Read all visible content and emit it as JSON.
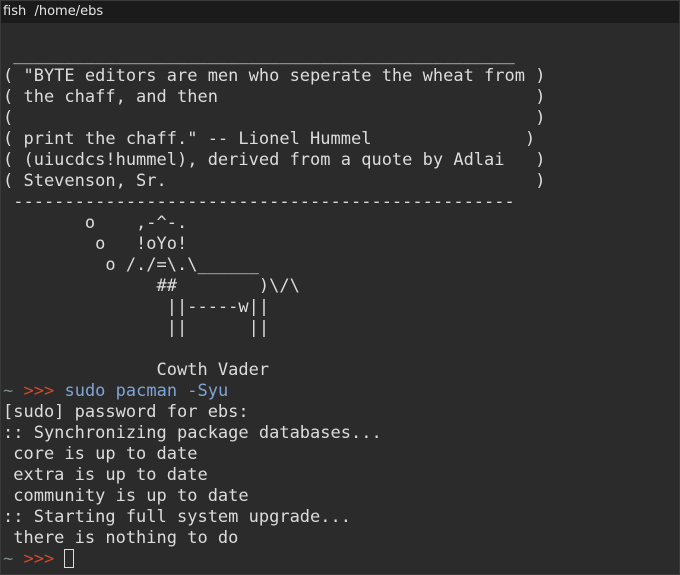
{
  "window": {
    "title": "fish  /home/ebs"
  },
  "cowsay": {
    "lines": [
      " _________________________________________________",
      "( \"BYTE editors are men who seperate the wheat from )",
      "( the chaff, and then                               )",
      "(                                                   )",
      "( print the chaff.\" -- Lionel Hummel               )",
      "( (uiucdcs!hummel), derived from a quote by Adlai   )",
      "( Stevenson, Sr.                                    )",
      " -------------------------------------------------",
      "        o    ,-^-.",
      "         o   !oYo!",
      "          o /./=\\.\\______",
      "               ##        )\\/\\",
      "                ||-----w||",
      "                ||      ||",
      "",
      "               Cowth Vader"
    ]
  },
  "command": {
    "prompt_tilde": "~",
    "prompt_arrows": ">>>",
    "text": "sudo pacman -Syu"
  },
  "output": {
    "lines": [
      "[sudo] password for ebs:",
      ":: Synchronizing package databases...",
      " core is up to date",
      " extra is up to date",
      " community is up to date",
      ":: Starting full system upgrade...",
      " there is nothing to do"
    ]
  },
  "final_prompt": {
    "prompt_tilde": "~",
    "prompt_arrows": ">>>"
  },
  "colors": {
    "background": "#2b2b2b",
    "foreground": "#dcdcdc",
    "prompt_arrows": "#d24a2a",
    "command": "#7fa4d8"
  }
}
